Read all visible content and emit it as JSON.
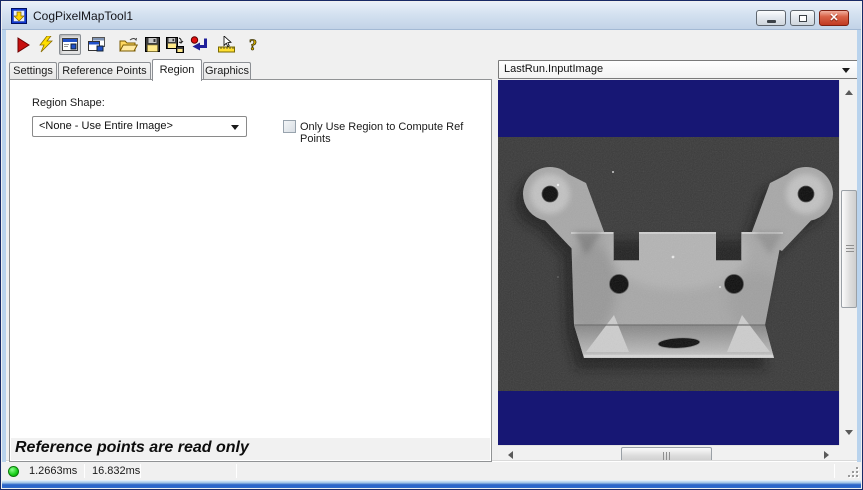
{
  "window": {
    "title": "CogPixelMapTool1"
  },
  "titlebar_controls": [
    "minimize",
    "maximize",
    "close"
  ],
  "toolbar": {
    "buttons": [
      "run",
      "trigger",
      "show-result-window",
      "new-result-window",
      "open-file",
      "save-file",
      "save-file-as",
      "reset",
      "measure",
      "help"
    ]
  },
  "tabs": {
    "settings": "Settings",
    "reference_points": "Reference Points",
    "region": "Region",
    "graphics": "Graphics",
    "active": "Region"
  },
  "region_tab": {
    "shape_label": "Region Shape:",
    "shape_value": "<None - Use Entire Image>",
    "only_use_region_label": "Only Use Region to Compute Ref Points",
    "only_use_region_checked": false,
    "message": "Reference points are read only"
  },
  "image_panel": {
    "view_selector": "LastRun.InputImage",
    "content": "grayscale photo of a stamped metal bracket on dark background",
    "letterbox_color": "#171774",
    "photo_background": "#3a3a3a"
  },
  "status_bar": {
    "status_ok_color": "#17cd17",
    "time_1": "1.2663ms",
    "time_2": "16.832ms"
  },
  "colors": {
    "titlebar": "#d4e1f0",
    "frame": "#b9d3ed",
    "close_button": "#c03a22",
    "chrome": "#f0f0f0"
  }
}
